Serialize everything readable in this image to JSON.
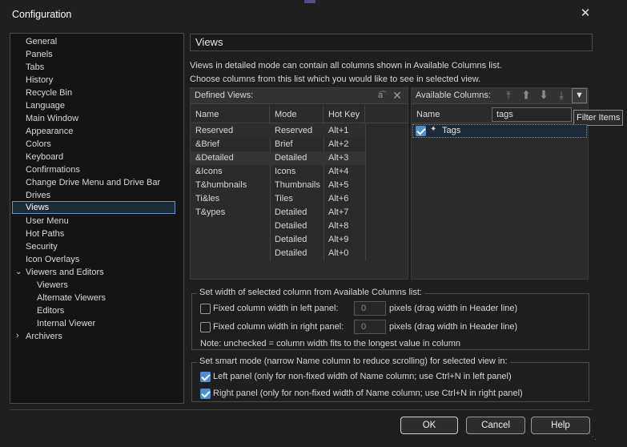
{
  "window": {
    "title": "Configuration",
    "close_glyph": "✕"
  },
  "sidebar": {
    "items": [
      {
        "label": "General"
      },
      {
        "label": "Panels"
      },
      {
        "label": "Tabs"
      },
      {
        "label": "History"
      },
      {
        "label": "Recycle Bin"
      },
      {
        "label": "Language"
      },
      {
        "label": "Main Window"
      },
      {
        "label": "Appearance"
      },
      {
        "label": "Colors"
      },
      {
        "label": "Keyboard"
      },
      {
        "label": "Confirmations"
      },
      {
        "label": "Change Drive Menu and Drive Bar"
      },
      {
        "label": "Drives"
      },
      {
        "label": "Views"
      },
      {
        "label": "User Menu"
      },
      {
        "label": "Hot Paths"
      },
      {
        "label": "Security"
      },
      {
        "label": "Icon Overlays"
      },
      {
        "label": "Viewers and Editors"
      },
      {
        "label": "Viewers"
      },
      {
        "label": "Alternate Viewers"
      },
      {
        "label": "Editors"
      },
      {
        "label": "Internal Viewer"
      },
      {
        "label": "Archivers"
      }
    ]
  },
  "page": {
    "title": "Views",
    "desc1": "Views in detailed mode can contain all columns shown in Available Columns list.",
    "desc2": "Choose columns from this list which you would like to see in selected view."
  },
  "defined_views": {
    "label": "Defined Views:",
    "columns": [
      "Name",
      "Mode",
      "Hot Key"
    ],
    "rows": [
      {
        "name": "Reserved",
        "mode": "Reserved",
        "hotkey": "Alt+1"
      },
      {
        "name": "&Brief",
        "mode": "Brief",
        "hotkey": "Alt+2"
      },
      {
        "name": "&Detailed",
        "mode": "Detailed",
        "hotkey": "Alt+3"
      },
      {
        "name": "&Icons",
        "mode": "Icons",
        "hotkey": "Alt+4"
      },
      {
        "name": "T&humbnails",
        "mode": "Thumbnails",
        "hotkey": "Alt+5"
      },
      {
        "name": "Ti&les",
        "mode": "Tiles",
        "hotkey": "Alt+6"
      },
      {
        "name": "T&ypes",
        "mode": "Detailed",
        "hotkey": "Alt+7"
      },
      {
        "name": "",
        "mode": "Detailed",
        "hotkey": "Alt+8"
      },
      {
        "name": "",
        "mode": "Detailed",
        "hotkey": "Alt+9"
      },
      {
        "name": "",
        "mode": "Detailed",
        "hotkey": "Alt+0"
      }
    ]
  },
  "available_columns": {
    "label": "Available Columns:",
    "column": "Name",
    "filter_value": "tags",
    "items": [
      {
        "label": "Tags",
        "checked": true
      }
    ],
    "tooltip": "Filter Items"
  },
  "width_group": {
    "legend": "Set width of selected column from Available Columns list:",
    "left_label": "Fixed column width in left panel:",
    "left_value": "0",
    "left_unit": "pixels (drag width in Header line)",
    "right_label": "Fixed column width in right panel:",
    "right_value": "0",
    "right_unit": "pixels (drag width in Header line)",
    "note": "Note: unchecked = column width fits to the longest value in column"
  },
  "smart_group": {
    "legend": "Set smart mode (narrow Name column to reduce scrolling) for selected view in:",
    "left": "Left panel (only for non-fixed width of Name column; use Ctrl+N in left panel)",
    "right": "Right panel (only for non-fixed width of Name column; use Ctrl+N in right panel)"
  },
  "buttons": {
    "ok": "OK",
    "cancel": "Cancel",
    "help": "Help"
  },
  "colors": {
    "accent": "#4d8fd6",
    "selection_border": "#6a8fb8",
    "background": "#1e1e1e"
  }
}
